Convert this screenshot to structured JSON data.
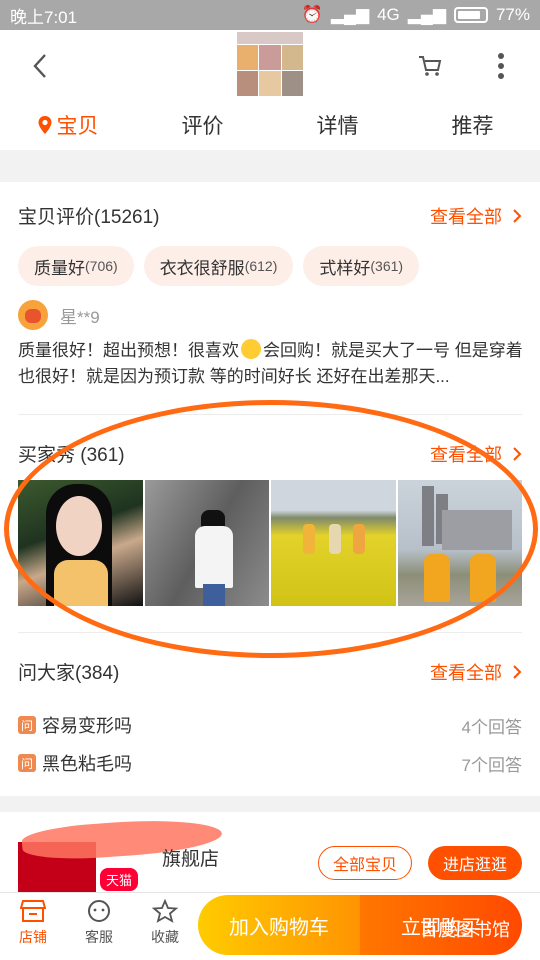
{
  "status_bar": {
    "time": "晚上7:01",
    "network": "4G",
    "battery": "77%"
  },
  "header": {
    "tabs": [
      "宝贝",
      "评价",
      "详情",
      "推荐"
    ]
  },
  "reviews": {
    "title": "宝贝评价(15261)",
    "see_all": "查看全部",
    "tags": [
      {
        "label": "质量好",
        "count": "(706)"
      },
      {
        "label": "衣衣很舒服",
        "count": "(612)"
      },
      {
        "label": "式样好",
        "count": "(361)"
      }
    ],
    "user": "星**9",
    "text_part1": "质量很好！超出预想！很喜欢",
    "text_part2": "会回购！就是买大了一号 但是穿着也很好！就是因为预订款 等的时间好长 还好在出差那天..."
  },
  "buyer_show": {
    "title": "买家秀 (361)",
    "see_all": "查看全部"
  },
  "qa": {
    "title": "问大家(384)",
    "see_all": "查看全部",
    "icon_char": "问",
    "items": [
      {
        "question": "容易变形吗",
        "answers": "4个回答"
      },
      {
        "question": "黑色粘毛吗",
        "answers": "7个回答"
      }
    ]
  },
  "shop": {
    "name_suffix": "旗舰店",
    "badge": "天猫",
    "all_items": "全部宝贝",
    "enter": "进店逛逛"
  },
  "bottom_bar": {
    "shop": "店铺",
    "service": "客服",
    "favorite": "收藏",
    "add_cart": "加入购物车",
    "buy_now": "立即购买"
  },
  "watermark": "百度图书馆",
  "colors": {
    "accent": "#ff5000",
    "annotation": "#ff6a13",
    "cart_yellow": "#ffcb00"
  }
}
